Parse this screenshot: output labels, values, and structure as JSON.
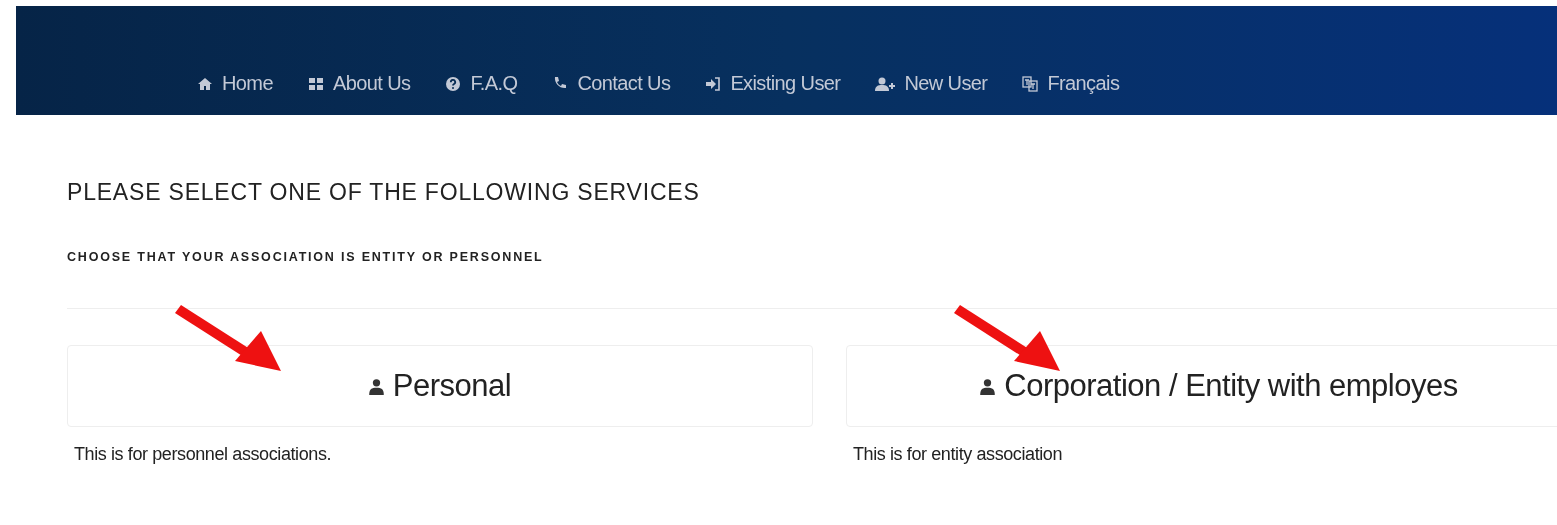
{
  "nav": {
    "items": [
      {
        "kind": "home",
        "label": "Home"
      },
      {
        "kind": "grid",
        "label": "About Us"
      },
      {
        "kind": "question",
        "label": "F.A.Q"
      },
      {
        "kind": "phone",
        "label": "Contact Us"
      },
      {
        "kind": "login",
        "label": "Existing User"
      },
      {
        "kind": "adduser",
        "label": "New User"
      },
      {
        "kind": "language",
        "label": "Français"
      }
    ]
  },
  "heading": "PLEASE SELECT ONE OF THE FOLLOWING SERVICES",
  "subheading": "CHOOSE THAT YOUR ASSOCIATION IS ENTITY OR PERSONNEL",
  "services": [
    {
      "title": "Personal",
      "description": "This is for personnel associations."
    },
    {
      "title": "Corporation / Entity with employes",
      "description": "This is for entity association"
    }
  ]
}
